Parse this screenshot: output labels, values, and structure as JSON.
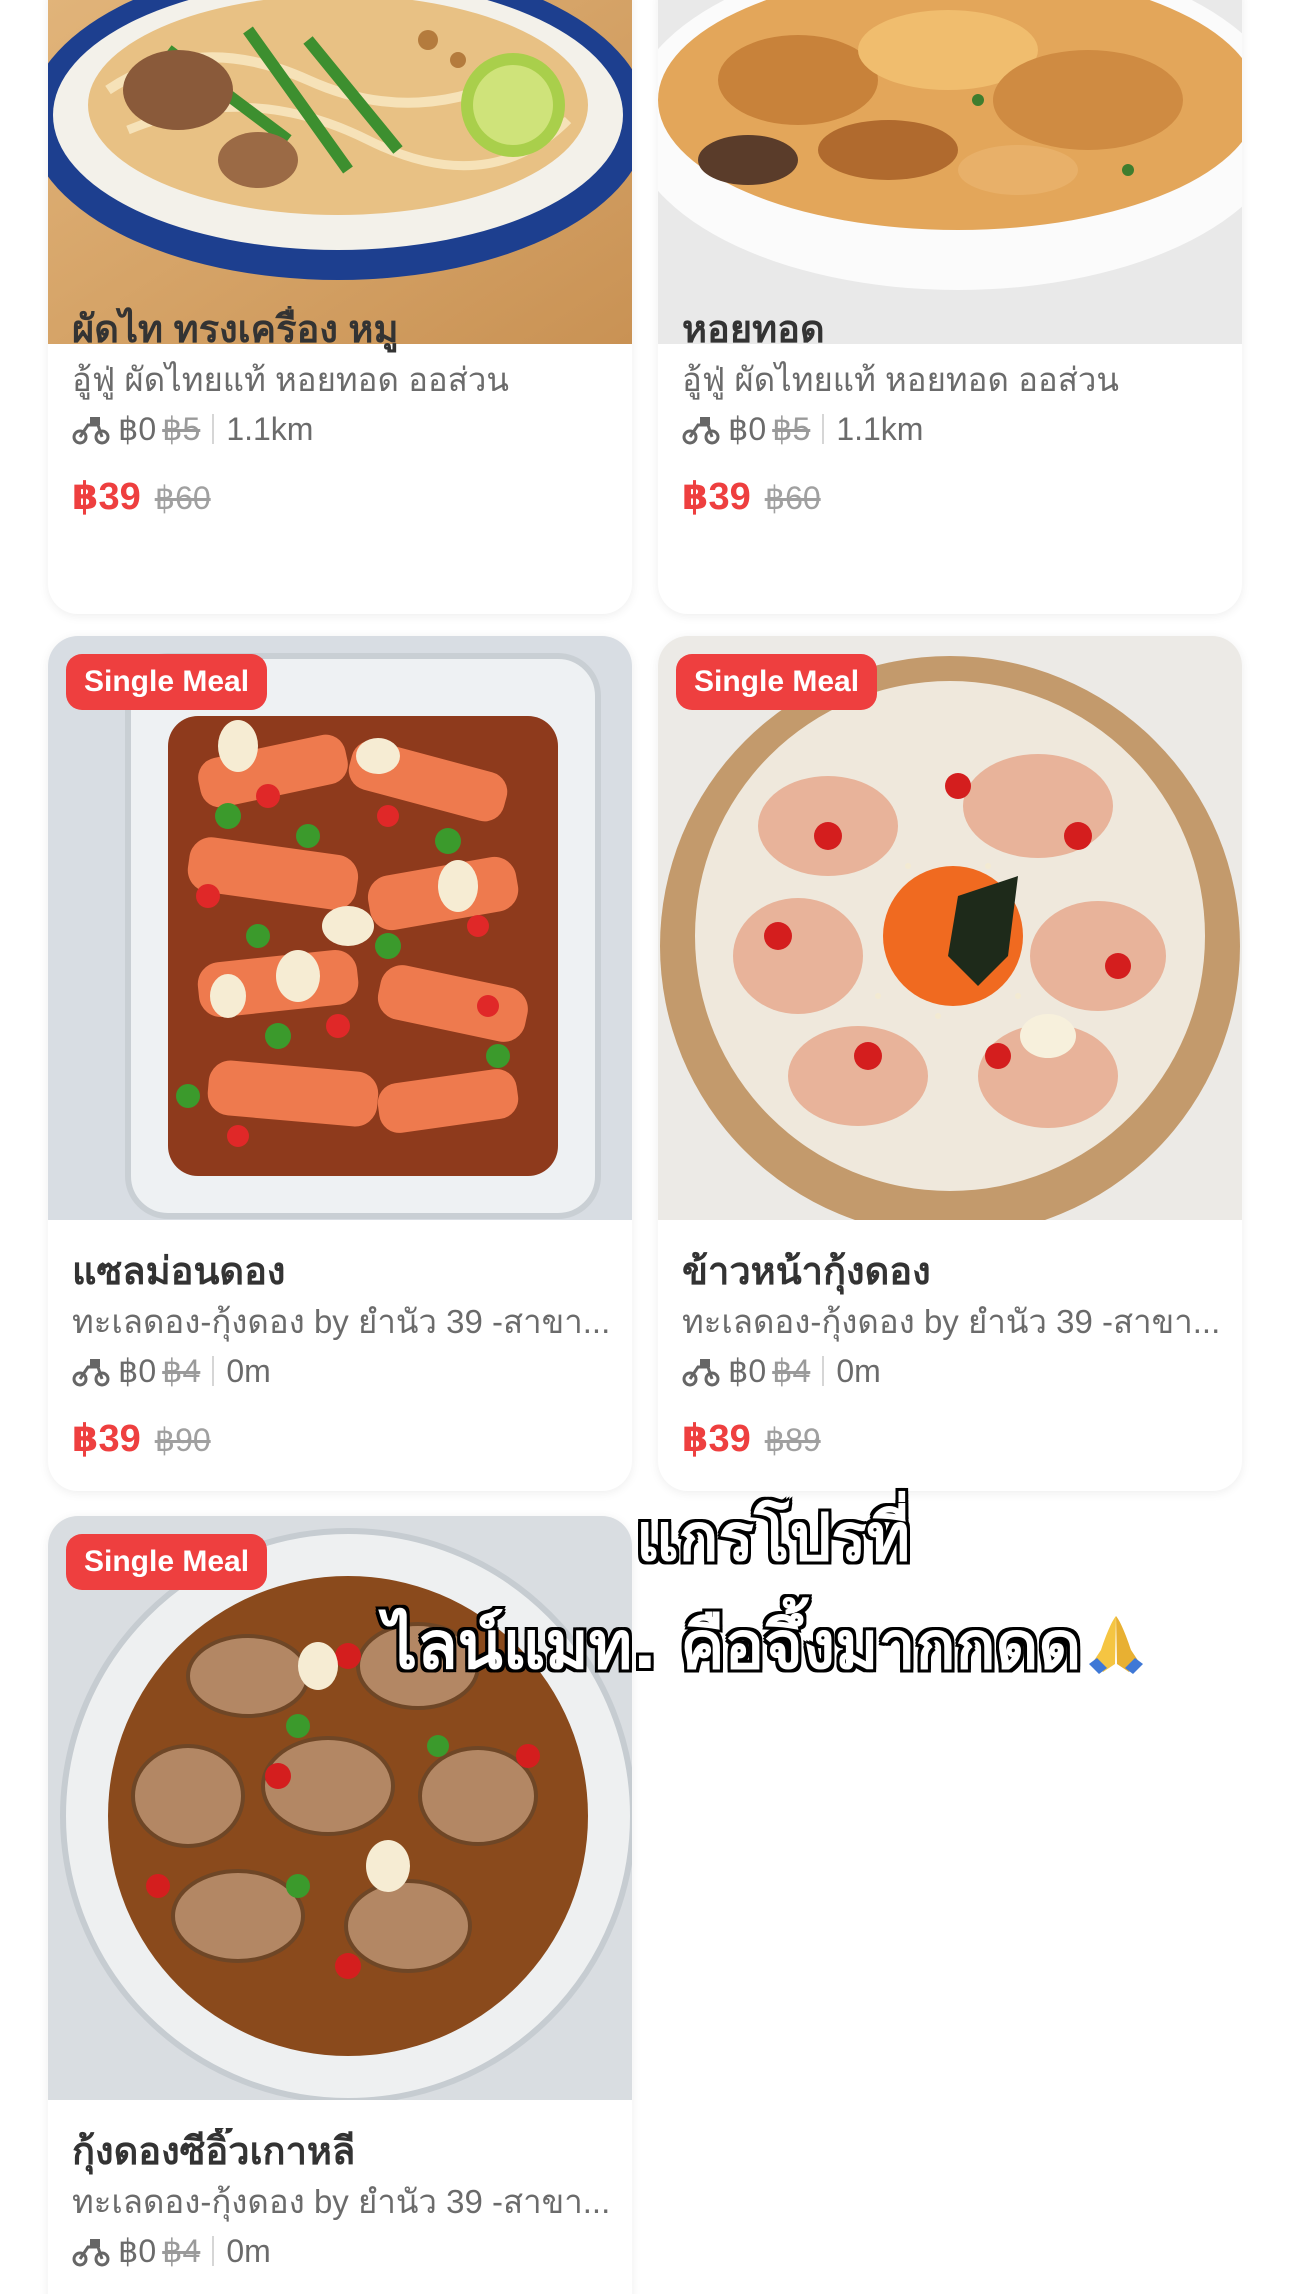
{
  "overlay_caption": {
    "line1": "แกรโปรที่",
    "line2": "ไลน์แมท. คือจึ้งมากกดด",
    "emoji_icon": "folded-hands-icon"
  },
  "products": [
    {
      "name": "ผัดไท ทรงเครื่อง หมู",
      "shop": "อู้ฟู่ ผัดไทยแท้ หอยทอด ออส่วน",
      "delivery_fee": "฿0",
      "delivery_fee_original": "฿5",
      "distance": "1.1km",
      "price": "฿39",
      "original_price": "฿60",
      "badge": "",
      "image": "pad-thai-photo"
    },
    {
      "name": "หอยทอด",
      "shop": "อู้ฟู่ ผัดไทยแท้ หอยทอด ออส่วน",
      "delivery_fee": "฿0",
      "delivery_fee_original": "฿5",
      "distance": "1.1km",
      "price": "฿39",
      "original_price": "฿60",
      "badge": "",
      "image": "fried-oyster-photo"
    },
    {
      "name": "แซลม่อนดอง",
      "shop": "ทะเลดอง-กุ้งดอง by ยำนัว 39 -สาขา...",
      "delivery_fee": "฿0",
      "delivery_fee_original": "฿4",
      "distance": "0m",
      "price": "฿39",
      "original_price": "฿90",
      "badge": "Single Meal",
      "image": "pickled-salmon-photo"
    },
    {
      "name": "ข้าวหน้ากุ้งดอง",
      "shop": "ทะเลดอง-กุ้งดอง by ยำนัว 39 -สาขา...",
      "delivery_fee": "฿0",
      "delivery_fee_original": "฿4",
      "distance": "0m",
      "price": "฿39",
      "original_price": "฿89",
      "badge": "Single Meal",
      "image": "shrimp-rice-bowl-photo"
    },
    {
      "name": "กุ้งดองซีอิ๊วเกาหลี",
      "shop": "ทะเลดอง-กุ้งดอง by ยำนัว 39 -สาขา...",
      "delivery_fee": "฿0",
      "delivery_fee_original": "฿4",
      "distance": "0m",
      "badge": "Single Meal",
      "image": "soy-pickled-shrimp-photo"
    }
  ],
  "colors": {
    "accent_red": "#ee3f3f",
    "text_dark": "#333333",
    "text_muted": "#6b6b6b",
    "background": "#ffffff"
  },
  "icons": {
    "delivery": "motorcycle-icon"
  }
}
